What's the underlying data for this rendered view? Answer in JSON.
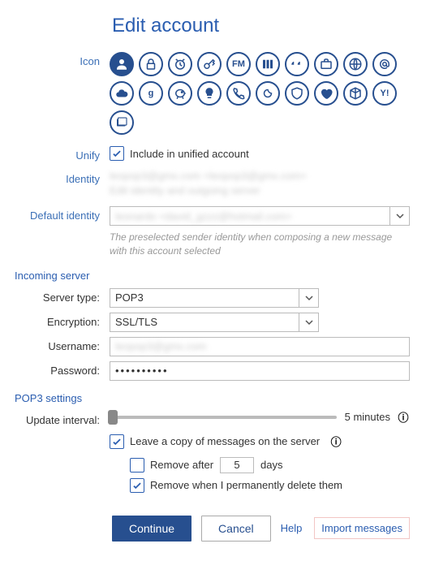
{
  "title": "Edit account",
  "labels": {
    "icon": "Icon",
    "unify": "Unify",
    "identity": "Identity",
    "default_identity": "Default identity",
    "server_type": "Server type:",
    "encryption": "Encryption:",
    "username": "Username:",
    "password": "Password:",
    "update_interval": "Update interval:"
  },
  "unify": {
    "label": "Include in unified account",
    "checked": true
  },
  "identity": {
    "line1": "leopop3@gmx.com <leopop3@gmx.com>",
    "edit_link": "Edit identity and outgoing server"
  },
  "default_identity": {
    "value": "leonardo <david_gzzz@hotmail.com>",
    "hint": "The preselected sender identity when composing a new message with this account selected"
  },
  "sections": {
    "incoming": "Incoming server",
    "pop3": "POP3 settings"
  },
  "server": {
    "type": "POP3",
    "encryption": "SSL/TLS",
    "username": "leopop3@gmx.com",
    "password": "••••••••••"
  },
  "update": {
    "value_text": "5 minutes"
  },
  "leave_copy": {
    "label": "Leave a copy of messages on the server",
    "checked": true
  },
  "remove_after": {
    "checked": false,
    "label_before": "Remove after",
    "value": "5",
    "label_after": "days"
  },
  "remove_delete": {
    "checked": true,
    "label": "Remove when I permanently delete them"
  },
  "buttons": {
    "continue": "Continue",
    "cancel": "Cancel",
    "help": "Help",
    "import": "Import messages"
  }
}
